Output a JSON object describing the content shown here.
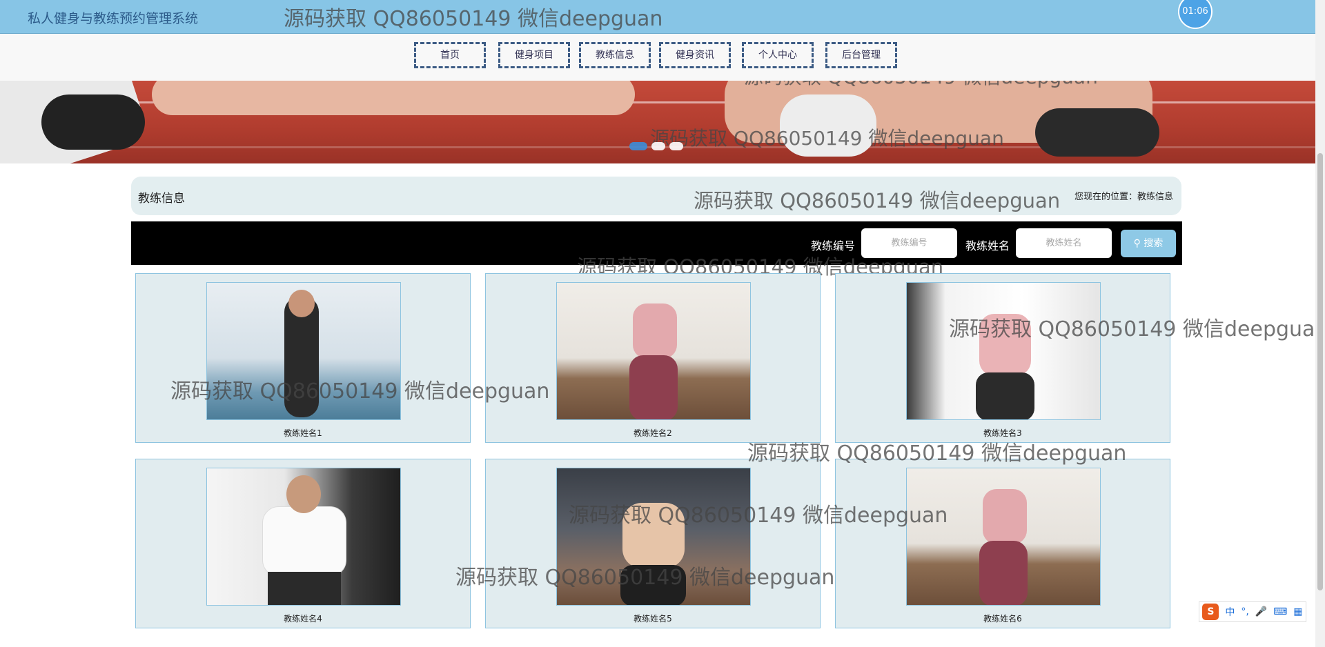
{
  "site_title": "私人健身与教练预约管理系统",
  "clock": "01:06",
  "nav": [
    "首页",
    "健身项目",
    "教练信息",
    "健身资讯",
    "个人中心",
    "后台管理"
  ],
  "section": {
    "title": "教练信息",
    "breadcrumb": "您现在的位置：教练信息"
  },
  "search": {
    "id_label": "教练编号",
    "id_placeholder": "教练编号",
    "name_label": "教练姓名",
    "name_placeholder": "教练姓名",
    "button": "搜索"
  },
  "coaches": [
    "教练姓名1",
    "教练姓名2",
    "教练姓名3",
    "教练姓名4",
    "教练姓名5",
    "教练姓名6"
  ],
  "watermark": "源码获取 QQ86050149 微信deepguan",
  "ime": {
    "logo": "S",
    "mode": "中"
  },
  "colors": {
    "topbar": "#87c5e6",
    "card_bg": "#e1ecef",
    "search_button": "#8ec9e6"
  }
}
